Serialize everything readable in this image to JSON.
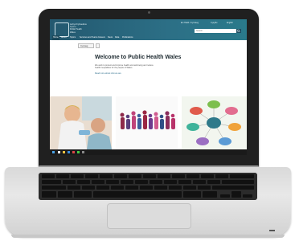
{
  "website": {
    "org_name_lines": [
      "Iechyd Cyhoeddus",
      "Cymru",
      "Public Health",
      "Wales"
    ],
    "top_links": [
      "Ein Hiaith / Cymraeg",
      "Cysylltu",
      "English"
    ],
    "search": {
      "placeholder": "Search"
    },
    "nav": [
      "Home",
      "About",
      "Topics",
      "Services and Teams",
      "Careers",
      "News",
      "Data",
      "Publications"
    ],
    "language_selector": "Cymraeg",
    "hero": {
      "title": "Welcome to Public Health Wales",
      "subtitle": "We work to protect and improve health and well-being and reduce health inequalities for the people of Wales.",
      "link": "Read more about who we are"
    },
    "tiles": [
      "child-with-nurse-photo",
      "crowd-silhouettes-illustration",
      "strategic-priorities-diagram"
    ]
  },
  "colors": {
    "header": "#2c6f86",
    "nav_dark": "#1e4a5c",
    "laptop_bezel": "#202020",
    "laptop_body": "#dcdcdc"
  }
}
